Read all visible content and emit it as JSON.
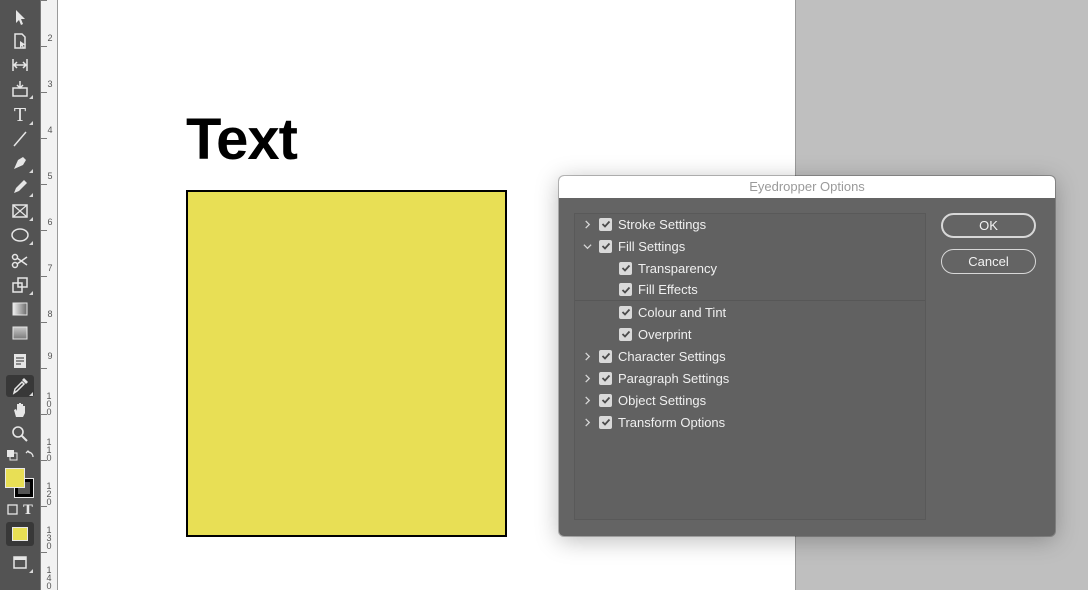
{
  "app": {
    "accent_yellow": "#e8df55",
    "toolbar_color": "#535353"
  },
  "toolbar": {
    "tools": [
      {
        "name": "selection-tool",
        "icon": "arrow-icon"
      },
      {
        "name": "page-tool",
        "icon": "page-icon"
      },
      {
        "name": "gap-tool",
        "icon": "gap-icon"
      },
      {
        "name": "content-collector-tool",
        "icon": "collector-icon"
      },
      {
        "name": "type-tool",
        "icon": "type-icon",
        "glyph": "T"
      },
      {
        "name": "line-tool",
        "icon": "line-icon"
      },
      {
        "name": "pen-tool",
        "icon": "pen-icon"
      },
      {
        "name": "pencil-tool",
        "icon": "pencil-icon"
      },
      {
        "name": "rectangle-frame-tool",
        "icon": "frame-icon"
      },
      {
        "name": "ellipse-tool",
        "icon": "ellipse-icon"
      },
      {
        "name": "scissors-tool",
        "icon": "scissors-icon"
      },
      {
        "name": "free-transform-tool",
        "icon": "transform-icon"
      },
      {
        "name": "gradient-swatch-tool",
        "icon": "gradient-icon"
      },
      {
        "name": "gradient-feather-tool",
        "icon": "feather-icon"
      },
      {
        "name": "note-tool",
        "icon": "note-icon"
      },
      {
        "name": "eyedropper-tool",
        "icon": "eyedropper-icon",
        "active": true
      },
      {
        "name": "hand-tool",
        "icon": "hand-icon"
      },
      {
        "name": "zoom-tool",
        "icon": "zoom-icon"
      }
    ],
    "format_text_label": "T"
  },
  "ruler": {
    "labels": [
      "2",
      "3",
      "4",
      "5",
      "6",
      "7",
      "8",
      "9",
      "100",
      "110",
      "120",
      "130",
      "140"
    ]
  },
  "canvas": {
    "text_frame": "Text",
    "rectangle_fill": "#e8df55"
  },
  "dialog": {
    "title": "Eyedropper Options",
    "ok_label": "OK",
    "cancel_label": "Cancel",
    "options": [
      {
        "label": "Stroke Settings",
        "level": 0,
        "expanded": false,
        "checked": true
      },
      {
        "label": "Fill Settings",
        "level": 0,
        "expanded": true,
        "checked": true
      },
      {
        "label": "Transparency",
        "level": 1,
        "checked": true
      },
      {
        "label": "Fill Effects",
        "level": 1,
        "checked": true
      },
      {
        "label": "Colour and Tint",
        "level": 1,
        "checked": true
      },
      {
        "label": "Overprint",
        "level": 1,
        "checked": true
      },
      {
        "label": "Character Settings",
        "level": 0,
        "expanded": false,
        "checked": true
      },
      {
        "label": "Paragraph Settings",
        "level": 0,
        "expanded": false,
        "checked": true
      },
      {
        "label": "Object Settings",
        "level": 0,
        "expanded": false,
        "checked": true
      },
      {
        "label": "Transform Options",
        "level": 0,
        "expanded": false,
        "checked": true
      }
    ]
  }
}
